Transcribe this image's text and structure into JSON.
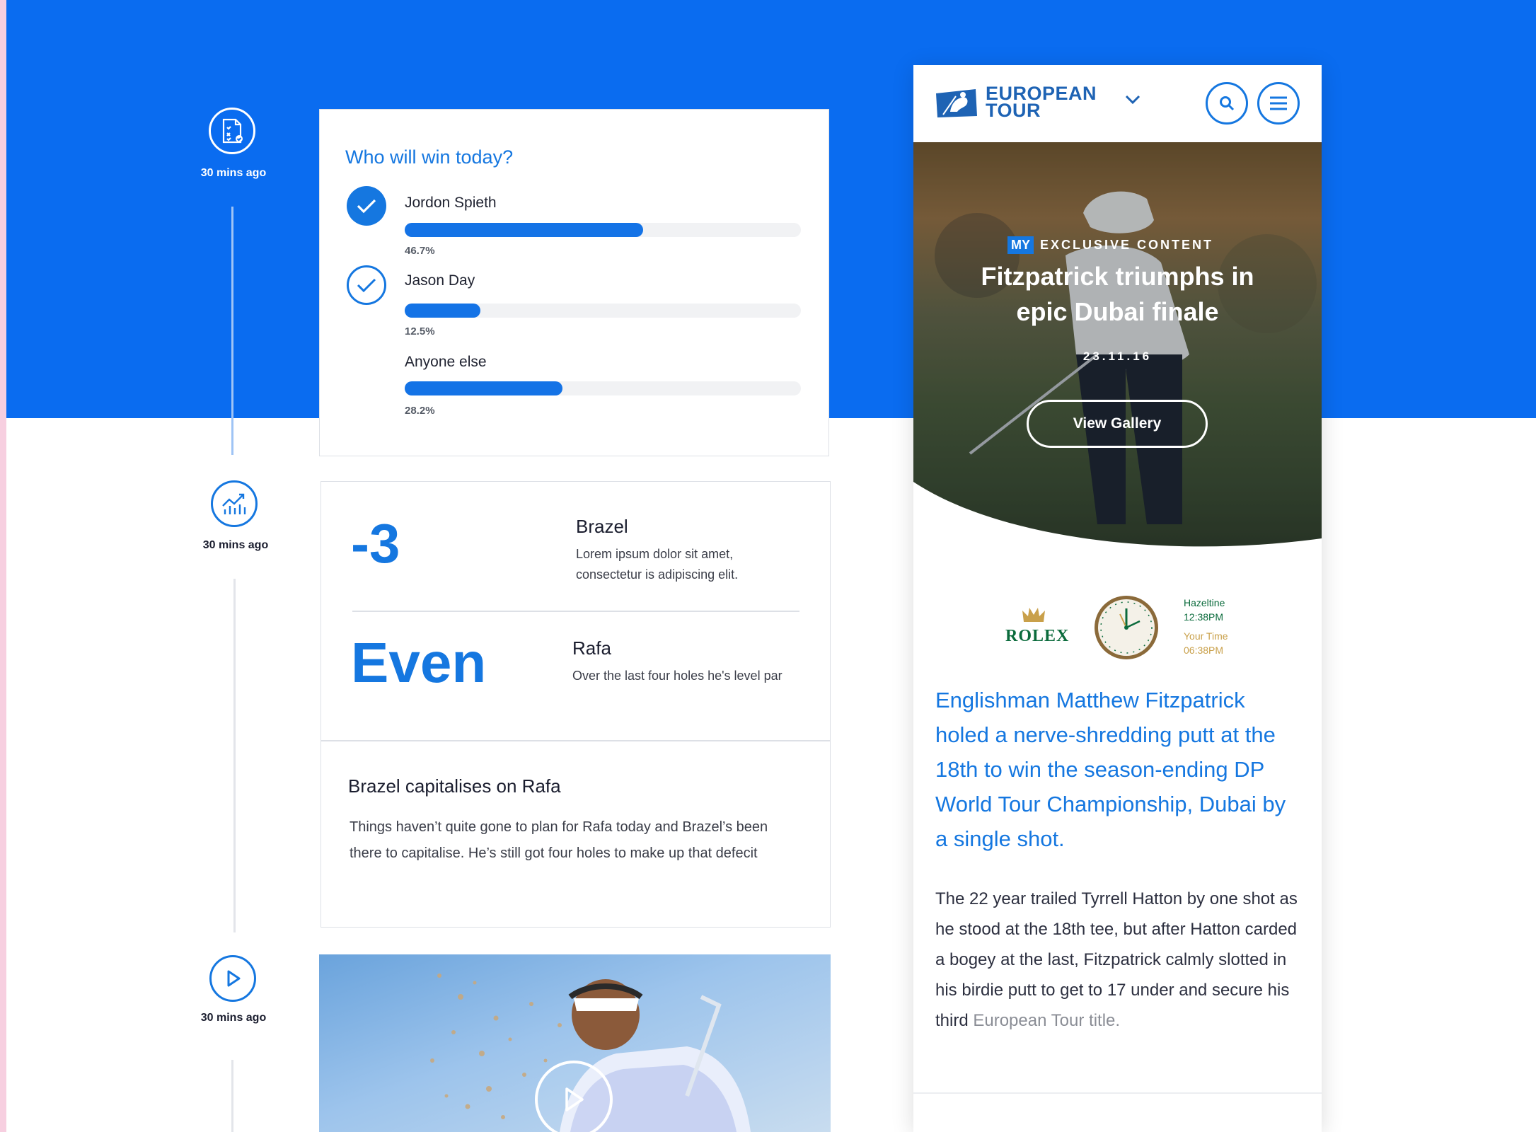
{
  "colors": {
    "primary_blue": "#0a6cf0",
    "accent_blue": "#1577e0",
    "rolex_green": "#0b6b3c",
    "gold": "#c9a04a"
  },
  "timeline": [
    {
      "time": "30 mins ago",
      "icon": "checklist-icon"
    },
    {
      "time": "30 mins ago",
      "icon": "stats-chart-icon"
    },
    {
      "time": "30 mins ago",
      "icon": "play-icon"
    }
  ],
  "poll": {
    "question": "Who will win today?",
    "options": [
      {
        "name": "Jordon Spieth",
        "percent_label": "46.7%",
        "fill": 0.6,
        "state": "selected"
      },
      {
        "name": "Jason Day",
        "percent_label": "12.5%",
        "fill": 0.19,
        "state": "outline"
      },
      {
        "name": "Anyone else",
        "percent_label": "28.2%",
        "fill": 0.4,
        "state": "none"
      }
    ]
  },
  "scores": [
    {
      "score": "-3",
      "player": "Brazel",
      "desc": "Lorem ipsum dolor sit amet, consectetur is adipiscing elit."
    },
    {
      "score": "Even",
      "player": "Rafa",
      "desc": "Over the last four holes he's level par"
    }
  ],
  "news": {
    "title": "Brazel capitalises on Rafa",
    "body": "Things haven’t quite gone to plan for Rafa today and Brazel’s been there to capitalise. He’s still got four holes to make up that defecit"
  },
  "phone": {
    "logo_line1": "EUROPEAN",
    "logo_line2": "TOUR",
    "hero": {
      "badge_my": "MY",
      "badge_text": "EXCLUSIVE CONTENT",
      "title": "Fitzpatrick triumphs in epic Dubai finale",
      "date": "23.11.16",
      "button": "View Gallery"
    },
    "rolex": {
      "brand": "ROLEX",
      "location": "Hazeltine",
      "location_time": "12:38PM",
      "your_time_label": "Your Time",
      "your_time": "06:38PM"
    },
    "lead": "Englishman Matthew Fitzpatrick holed a nerve-shredding putt at the 18th to win the season-ending DP World Tour Championship, Dubai by a single shot.",
    "article_main": "The 22 year trailed Tyrrell Hatton by one shot as he stood at the 18th tee, but after Hatton carded a bogey at the last, Fitzpatrick calmly slotted in his birdie putt to get to 17 under and secure his third",
    "article_fade": "European Tour title."
  }
}
